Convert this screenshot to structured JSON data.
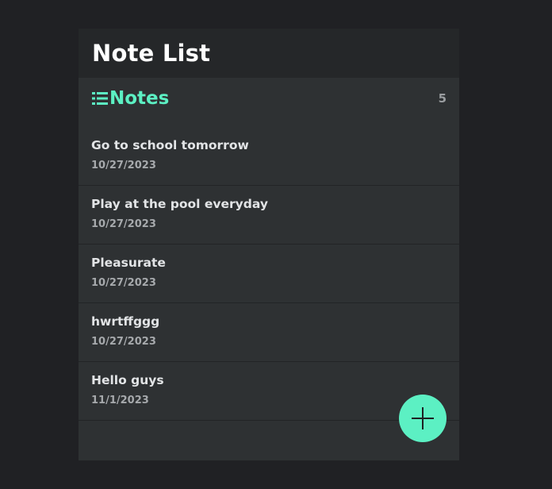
{
  "header": {
    "title": "Note List"
  },
  "section": {
    "label": "Notes",
    "icon": "list-icon",
    "count": "5"
  },
  "notes": [
    {
      "title": "Go to school tomorrow",
      "date": "10/27/2023"
    },
    {
      "title": "Play at the pool everyday",
      "date": "10/27/2023"
    },
    {
      "title": "Pleasurate",
      "date": "10/27/2023"
    },
    {
      "title": "hwrtffggg",
      "date": "10/27/2023"
    },
    {
      "title": "Hello guys",
      "date": "11/1/2023"
    }
  ],
  "fab": {
    "icon": "plus-icon"
  },
  "colors": {
    "accent": "#5cf0c3",
    "background": "#202124",
    "panel": "#2e3133",
    "header": "#252729"
  }
}
